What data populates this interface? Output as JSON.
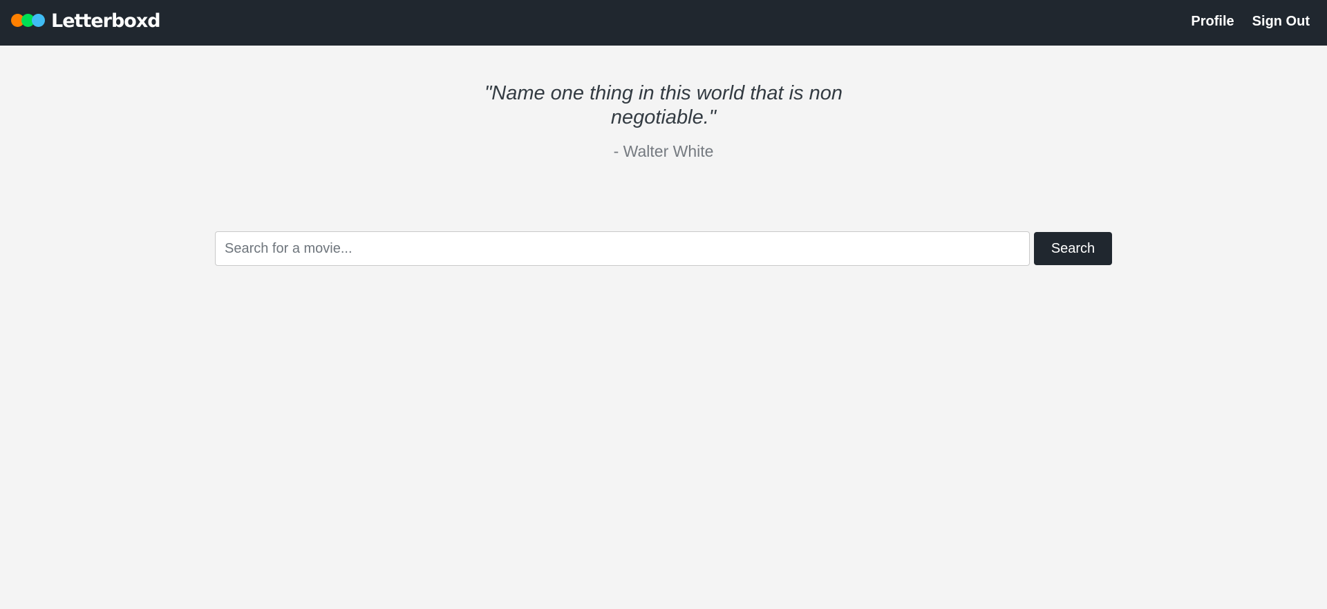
{
  "header": {
    "brand": {
      "name": "Letterboxd",
      "logo_dots": [
        "#ff8000",
        "#00e054",
        "#40bcf4"
      ]
    },
    "nav": {
      "profile_label": "Profile",
      "signout_label": "Sign Out"
    },
    "background_color": "#20272f"
  },
  "main": {
    "quote": "\"Name one thing in this world that is non negotiable.\"",
    "author": "- Walter White",
    "search": {
      "placeholder": "Search for a movie...",
      "value": "",
      "button_label": "Search"
    }
  }
}
